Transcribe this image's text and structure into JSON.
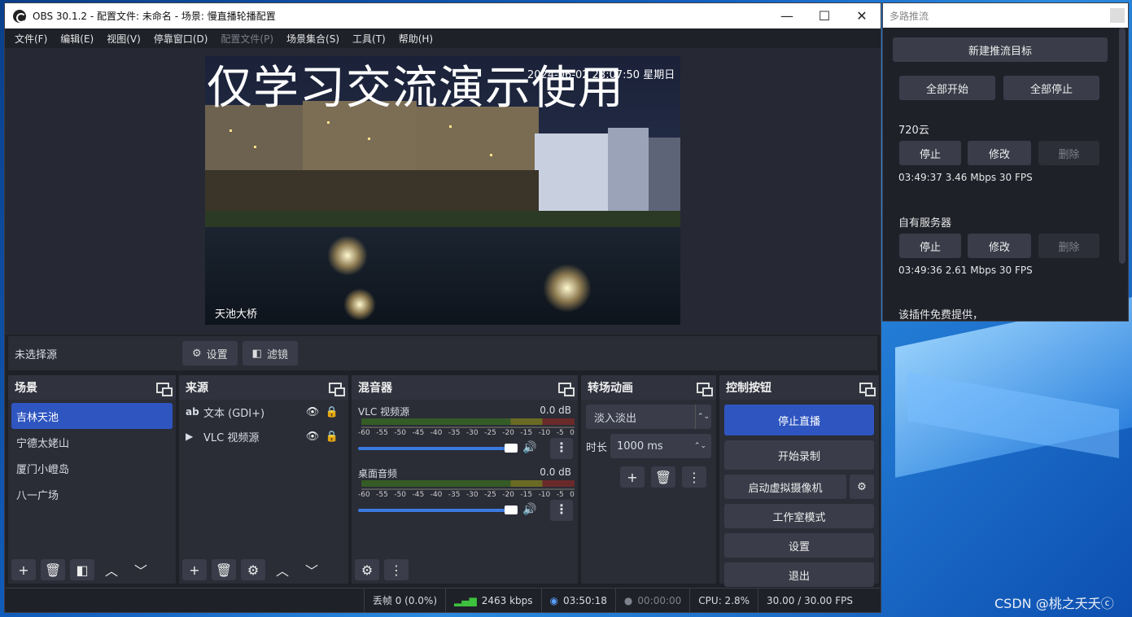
{
  "window": {
    "title": "OBS 30.1.2 - 配置文件: 未命名 - 场景: 慢直播轮播配置",
    "minimize": "—",
    "maximize": "☐",
    "close": "✕"
  },
  "menu": [
    "文件(F)",
    "编辑(E)",
    "视图(V)",
    "停靠窗口(D)",
    "配置文件(P)",
    "场景集合(S)",
    "工具(T)",
    "帮助(H)"
  ],
  "preview": {
    "overlay_title": "仅学习交流演示使用",
    "timestamp": "2024-06-02 23:07:50 星期日",
    "caption": "天池大桥"
  },
  "source_bar": {
    "no_source": "未选择源",
    "settings": "设置",
    "filters": "滤镜"
  },
  "scenes": {
    "title": "场景",
    "items": [
      "吉林天池",
      "宁德太姥山",
      "厦门小嶝岛",
      "八一广场"
    ],
    "selected_index": 0
  },
  "sources": {
    "title": "来源",
    "items": [
      {
        "icon": "ab",
        "name": "文本 (GDI+)"
      },
      {
        "icon": "▶",
        "name": "VLC 视频源"
      }
    ]
  },
  "mixer": {
    "title": "混音器",
    "scale": [
      "-60",
      "-55",
      "-50",
      "-45",
      "-40",
      "-35",
      "-30",
      "-25",
      "-20",
      "-15",
      "-10",
      "-5",
      "0"
    ],
    "channels": [
      {
        "name": "VLC 视频源",
        "db": "0.0 dB"
      },
      {
        "name": "桌面音频",
        "db": "0.0 dB"
      }
    ]
  },
  "transitions": {
    "title": "转场动画",
    "type": "淡入淡出",
    "duration_label": "时长",
    "duration": "1000 ms"
  },
  "controls": {
    "title": "控制按钮",
    "stop_stream": "停止直播",
    "start_record": "开始录制",
    "virtual_cam": "启动虚拟摄像机",
    "studio_mode": "工作室模式",
    "settings": "设置",
    "exit": "退出"
  },
  "status": {
    "dropped": "丢帧 0 (0.0%)",
    "bitrate": "2463 kbps",
    "stream_time": "03:50:18",
    "record_time": "00:00:00",
    "cpu": "CPU: 2.8%",
    "fps": "30.00 / 30.00 FPS"
  },
  "multi_push": {
    "title": "多路推流",
    "new_target": "新建推流目标",
    "start_all": "全部开始",
    "stop_all": "全部停止",
    "targets": [
      {
        "name": "720云",
        "stop": "停止",
        "edit": "修改",
        "delete": "删除",
        "stats": "03:49:37  3.46 Mbps  30 FPS"
      },
      {
        "name": "自有服务器",
        "stop": "停止",
        "edit": "修改",
        "delete": "删除",
        "stats": "03:49:36  2.61 Mbps  30 FPS"
      }
    ],
    "note": "该插件免费提供，"
  },
  "watermark": "CSDN @桃之夭夭ⓒ",
  "colors": {
    "accent": "#2e55c0",
    "bg": "#1f2129",
    "panel": "#2a2c36"
  }
}
